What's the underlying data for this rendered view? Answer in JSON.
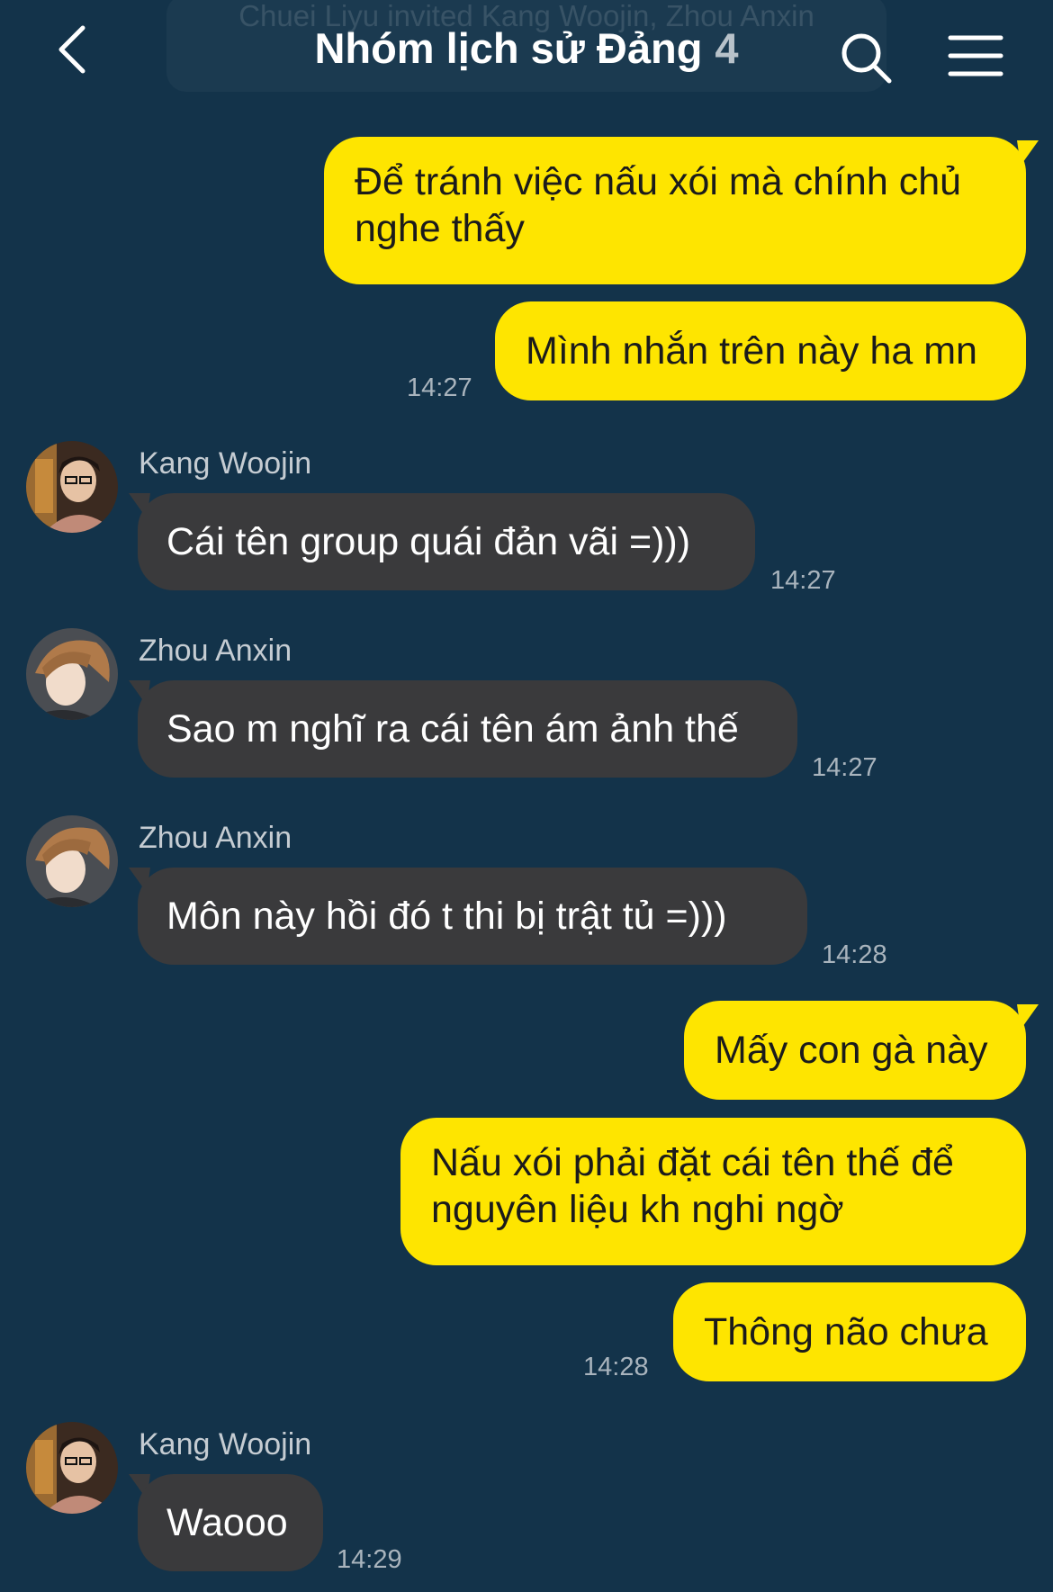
{
  "header": {
    "system_notice": "Chuei Liyu invited Kang Woojin, Zhou Anxin",
    "title": "Nhóm lịch sử Đảng",
    "member_count": "4"
  },
  "messages": {
    "m1": "Để tránh việc nấu xói mà chính chủ nghe thấy",
    "m2": "Mình nhắn trên này ha mn",
    "t2": "14:27",
    "m3_sender": "Kang Woojin",
    "m3": "Cái tên group quái đản vãi =)))",
    "t3": "14:27",
    "m4_sender": "Zhou Anxin",
    "m4": "Sao m nghĩ ra cái tên ám ảnh thế",
    "t4": "14:27",
    "m5_sender": "Zhou Anxin",
    "m5": "Môn này hồi đó t thi bị trật tủ =)))",
    "t5": "14:28",
    "m6": "Mấy con gà này",
    "m7": "Nấu xói phải đặt cái tên thế để nguyên liệu kh nghi ngờ",
    "m8": "Thông não chưa",
    "t8": "14:28",
    "m9_sender": "Kang Woojin",
    "m9": "Waooo",
    "t9": "14:29"
  },
  "colors": {
    "background": "#13334a",
    "my_bubble": "#fee500",
    "their_bubble": "#3a3a3c",
    "timestamp": "#a9b4bd"
  },
  "icons": {
    "back": "chevron-left-icon",
    "search": "search-icon",
    "menu": "hamburger-menu-icon"
  }
}
